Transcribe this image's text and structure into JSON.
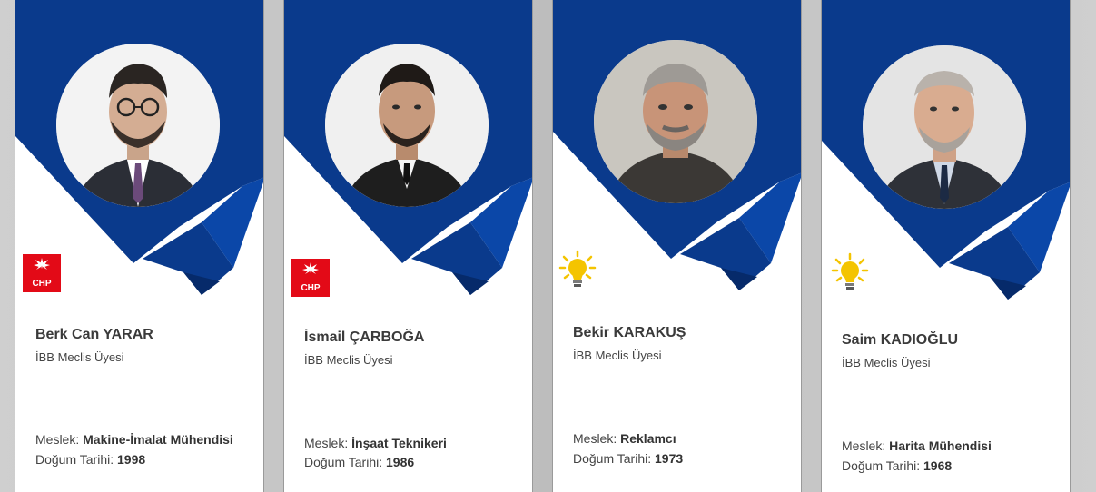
{
  "colors": {
    "ribbon": "#0a3a8c",
    "ribbon_dark": "#062a6a",
    "chp_red": "#e30a17",
    "akp_yellow": "#f4c400"
  },
  "members": [
    {
      "name": "Berk Can YARAR",
      "role": "İBB Meclis Üyesi",
      "profession_label": "Meslek:",
      "profession": "Makine-İmalat Mühendisi",
      "birth_label": "Doğum Tarihi:",
      "birth_year": "1998",
      "party_logo": "chp-logo-icon",
      "party_text": "CHP"
    },
    {
      "name": "İsmail ÇARBOĞA",
      "role": "İBB Meclis Üyesi",
      "profession_label": "Meslek:",
      "profession": "İnşaat Teknikeri",
      "birth_label": "Doğum Tarihi:",
      "birth_year": "1986",
      "party_logo": "chp-logo-icon",
      "party_text": "CHP"
    },
    {
      "name": "Bekir KARAKUŞ",
      "role": "İBB Meclis Üyesi",
      "profession_label": "Meslek:",
      "profession": "Reklamcı",
      "birth_label": "Doğum Tarihi:",
      "birth_year": "1973",
      "party_logo": "akp-lightbulb-icon"
    },
    {
      "name": "Saim KADIOĞLU",
      "role": "İBB Meclis Üyesi",
      "profession_label": "Meslek:",
      "profession": "Harita Mühendisi",
      "birth_label": "Doğum Tarihi:",
      "birth_year": "1968",
      "party_logo": "akp-lightbulb-icon"
    }
  ]
}
